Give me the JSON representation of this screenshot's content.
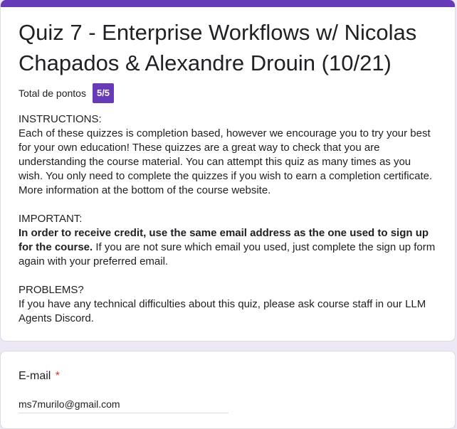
{
  "header": {
    "title": "Quiz 7 - Enterprise Workflows w/ Nicolas Chapados & Alexandre Drouin (10/21)",
    "score_label": "Total de pontos",
    "score_value": "5/5"
  },
  "instructions": {
    "heading": "INSTRUCTIONS:",
    "body": "Each of these quizzes is completion based, however we encourage you to try your best for your own education! These quizzes are a great way to check that you are understanding the course material. You can attempt this quiz as many times as you wish. You only need to complete the quizzes if you wish to earn a completion certificate. More information at the bottom of the course website.",
    "important_heading": "IMPORTANT:",
    "important_bold": "In order to receive credit, use the same email address as the one used to sign up for the course.",
    "important_rest": " If you are not sure which email you used, just complete the sign up form again with your preferred email.",
    "problems_heading": "PROBLEMS?",
    "problems_body": "If you have any technical difficulties about this quiz, please ask course staff in our LLM Agents Discord."
  },
  "email_question": {
    "label": "E-mail",
    "required_mark": "*",
    "value": "ms7murilo@gmail.com"
  },
  "colors": {
    "accent": "#673ab7",
    "background": "#ede7f6",
    "required": "#d93025"
  }
}
